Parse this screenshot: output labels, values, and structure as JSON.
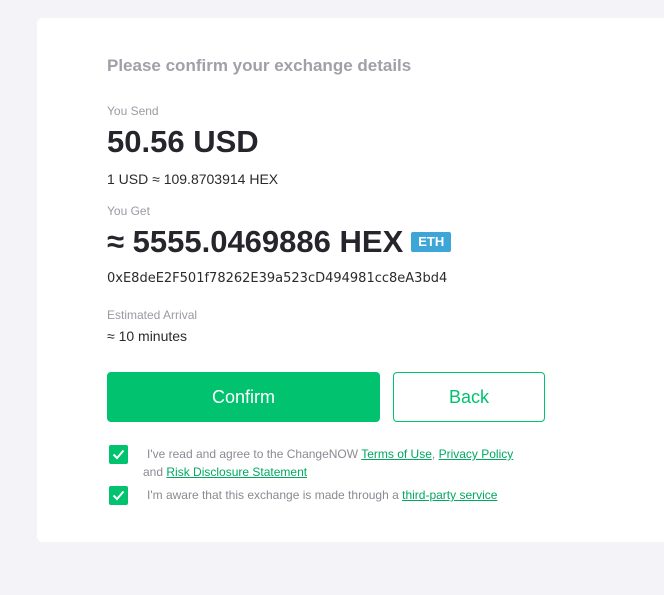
{
  "heading": "Please confirm your exchange details",
  "send": {
    "label": "You Send",
    "amount": "50.56 USD",
    "rate": "1 USD ≈ 109.8703914 HEX"
  },
  "get": {
    "label": "You Get",
    "amount": "≈ 5555.0469886 HEX",
    "network_badge": "ETH",
    "address": "0xE8deE2F501f78262E39a523cD494981cc8eA3bd4"
  },
  "arrival": {
    "label": "Estimated Arrival",
    "value": "≈ 10 minutes"
  },
  "buttons": {
    "confirm": "Confirm",
    "back": "Back"
  },
  "agreements": {
    "terms": {
      "prefix": "I've read and agree to the ChangeNOW ",
      "terms_link": "Terms of Use",
      "comma": ",",
      "privacy_link": "Privacy Policy",
      "and": " and ",
      "risk_link": "Risk Disclosure Statement",
      "checked": true
    },
    "third_party": {
      "prefix": "I'm aware that this exchange is made through a ",
      "link": "third-party service",
      "checked": true
    }
  },
  "colors": {
    "accent": "#00c26f",
    "badge": "#3ea6d6",
    "background": "#f4f4f8"
  }
}
